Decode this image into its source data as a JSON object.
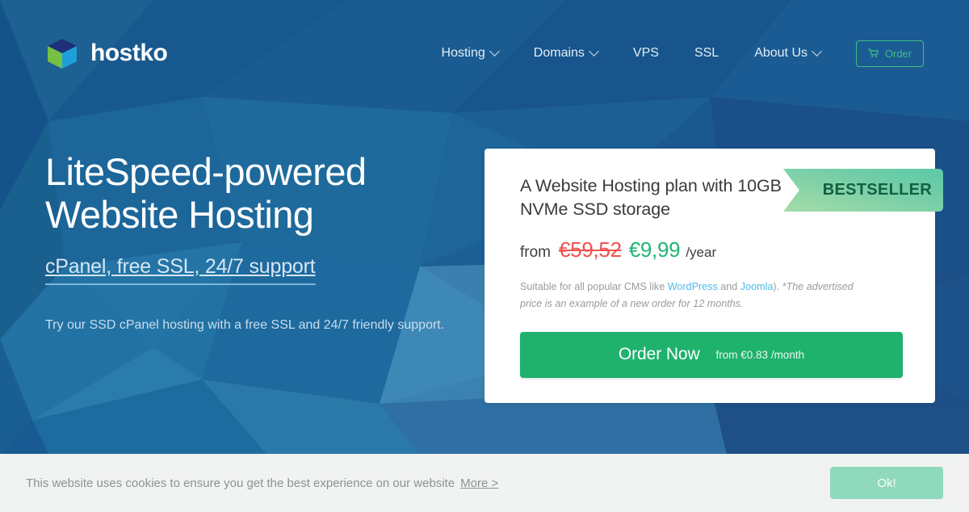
{
  "colors": {
    "hero_bg": "#1a5a93",
    "hero_dark": "#1c4b86",
    "accent_green": "#1eb26d",
    "price_old_red": "#ef5350",
    "price_new_green": "#21b573",
    "link_blue": "#4fb8e8",
    "ribbon_green_light": "#cfeccf",
    "ribbon_green_dark": "#5ec9a0",
    "cookie_bar_bg": "#f1f2f2",
    "cookie_ok_bg": "#8fd9bd"
  },
  "header": {
    "brand_name": "hostko",
    "logo_icon": "cube-icon",
    "nav": [
      {
        "label": "Hosting",
        "has_dropdown": true
      },
      {
        "label": "Domains",
        "has_dropdown": true
      },
      {
        "label": "VPS",
        "has_dropdown": false
      },
      {
        "label": "SSL",
        "has_dropdown": false
      },
      {
        "label": "About Us",
        "has_dropdown": true
      }
    ],
    "order_button": {
      "label": "Order",
      "icon": "shopping-cart-icon"
    }
  },
  "hero": {
    "title_line1": "LiteSpeed-powered",
    "title_line2": "Website Hosting",
    "subtitle": "cPanel, free SSL, 24/7 support",
    "paragraph": "Try our SSD cPanel hosting with a free SSL and 24/7 friendly support."
  },
  "card": {
    "ribbon_label": "BESTSELLER",
    "plan_title": "A Website Hosting plan with 10GB NVMe SSD storage",
    "price": {
      "from_label": "from",
      "old_price": "€59,52",
      "new_price": "€9,99",
      "period": "/year"
    },
    "description": {
      "lead": "Suitable for all popular CMS like ",
      "link1": "WordPress",
      "between": " and ",
      "link2": "Joomla",
      "tail": "). ",
      "note": "*The advertised price is an example of a new order for 12 months."
    },
    "cta": {
      "main_label": "Order Now",
      "sub_label": "from €0.83 /month"
    }
  },
  "cookie": {
    "message": "This website uses cookies to ensure you get the best experience on our website",
    "more_label": "More >",
    "ok_label": "Ok!"
  }
}
